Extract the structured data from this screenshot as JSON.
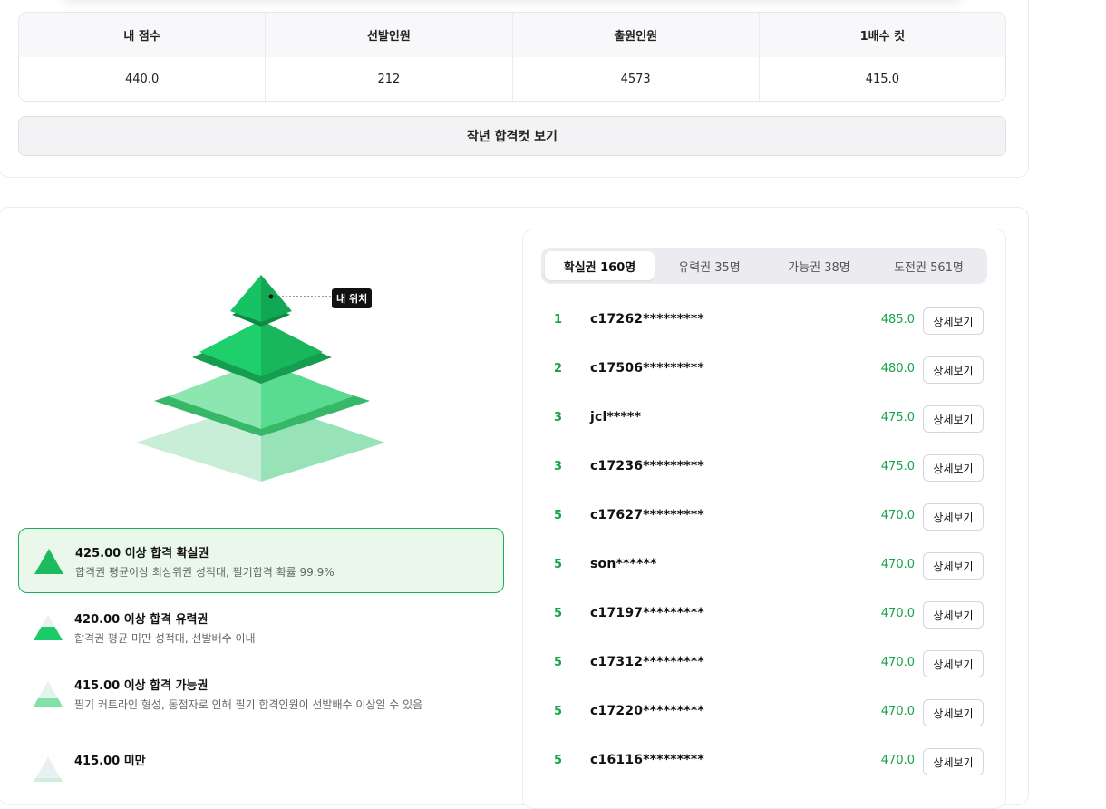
{
  "score_table": {
    "headers": [
      "내 점수",
      "선발인원",
      "출원인원",
      "1배수 컷"
    ],
    "values": [
      "440.0",
      "212",
      "4573",
      "415.0"
    ]
  },
  "last_year_button": "작년 합격컷 보기",
  "pyramid": {
    "my_position_label": "내 위치",
    "colors": {
      "tier1": "#16b35a",
      "tier2": "#1ec86a",
      "tier3": "#7fe3a8",
      "tier4": "#c9eed8"
    }
  },
  "legend": [
    {
      "title": "425.00 이상 합격 확실권",
      "desc": "합격권 평균이상 최상위권 성적대, 필기합격 확률 99.9%"
    },
    {
      "title": "420.00 이상 합격 유력권",
      "desc": "합격권 평균 미만 성적대, 선발배수 이내"
    },
    {
      "title": "415.00 이상 합격 가능권",
      "desc": "필기 커트라인 형성, 동점자로 인해 필기 합격인원이 선발배수 이상일 수 있음"
    },
    {
      "title": "415.00 미만",
      "desc": ""
    }
  ],
  "tabs": [
    "확실권 160명",
    "유력권 35명",
    "가능권 38명",
    "도전권 561명"
  ],
  "ranking": [
    {
      "rank": "1",
      "id": "c17262*********",
      "score": "485.0",
      "button": "상세보기"
    },
    {
      "rank": "2",
      "id": "c17506*********",
      "score": "480.0",
      "button": "상세보기"
    },
    {
      "rank": "3",
      "id": "jcl*****",
      "score": "475.0",
      "button": "상세보기"
    },
    {
      "rank": "3",
      "id": "c17236*********",
      "score": "475.0",
      "button": "상세보기"
    },
    {
      "rank": "5",
      "id": "c17627*********",
      "score": "470.0",
      "button": "상세보기"
    },
    {
      "rank": "5",
      "id": "son******",
      "score": "470.0",
      "button": "상세보기"
    },
    {
      "rank": "5",
      "id": "c17197*********",
      "score": "470.0",
      "button": "상세보기"
    },
    {
      "rank": "5",
      "id": "c17312*********",
      "score": "470.0",
      "button": "상세보기"
    },
    {
      "rank": "5",
      "id": "c17220*********",
      "score": "470.0",
      "button": "상세보기"
    },
    {
      "rank": "5",
      "id": "c16116*********",
      "score": "470.0",
      "button": "상세보기"
    }
  ]
}
